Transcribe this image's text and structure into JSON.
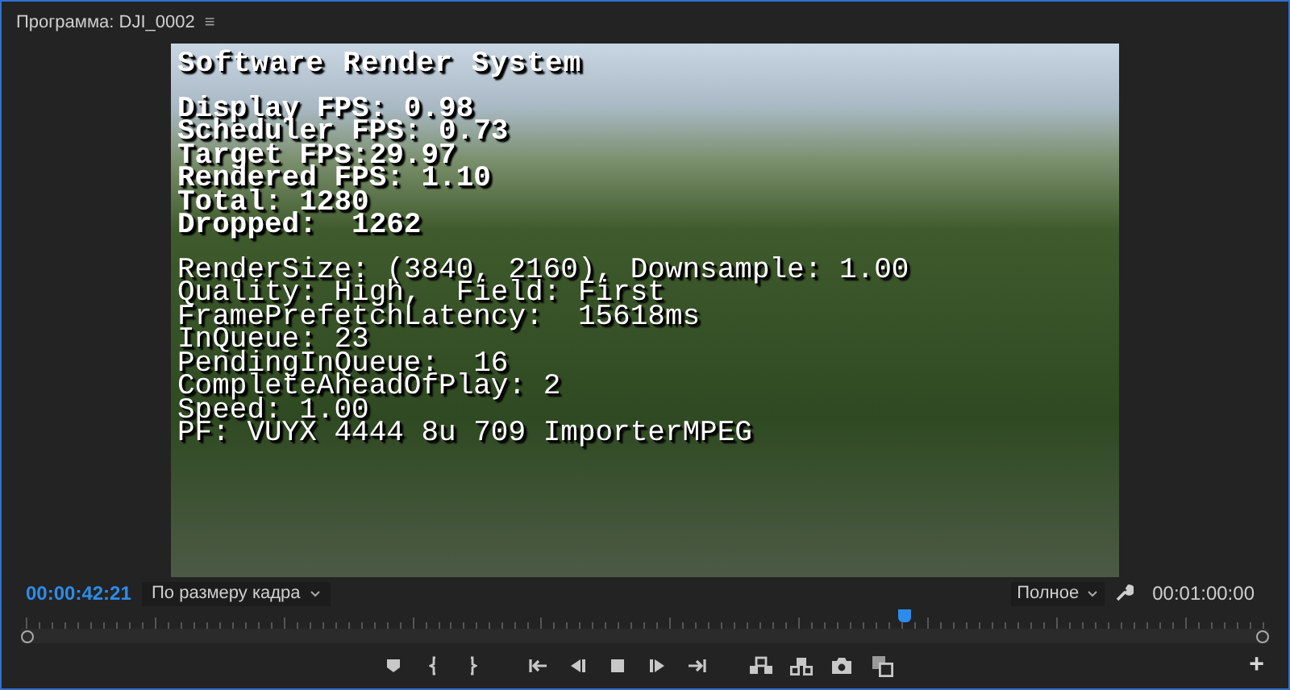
{
  "panel": {
    "title": "Программа: DJI_0002",
    "menu_glyph": "≡"
  },
  "overlay": {
    "title": "Software Render System",
    "stats": [
      "Display FPS: 0.98",
      "Scheduler FPS: 0.73",
      "Target FPS:29.97",
      "Rendered FPS: 1.10",
      "Total: 1280",
      "Dropped:  1262"
    ],
    "details": [
      "RenderSize: (3840, 2160), Downsample: 1.00",
      "Quality: High,  Field: First",
      "FramePrefetchLatency:  15618ms",
      "InQueue: 23",
      "PendingInQueue:  16",
      "CompleteAheadOfPlay: 2",
      "Speed: 1.00",
      "PF: VUYX 4444 8u 709 ImporterMPEG"
    ]
  },
  "timecode": "00:00:42:21",
  "zoom_select": {
    "value": "По размеру кадра"
  },
  "quality_select": {
    "value": "Полное"
  },
  "duration": "00:01:00:00",
  "playhead": {
    "level": 0.71
  },
  "controls": [
    {
      "kind": "marker"
    },
    {
      "kind": "mark-in"
    },
    {
      "kind": "mark-out"
    },
    {
      "kind": "go-in"
    },
    {
      "kind": "step-back"
    },
    {
      "kind": "stop"
    },
    {
      "kind": "step-forward"
    },
    {
      "kind": "go-out"
    },
    {
      "kind": "lift"
    },
    {
      "kind": "extract"
    },
    {
      "kind": "camera"
    },
    {
      "kind": "compare"
    }
  ],
  "add_glyph": "+"
}
